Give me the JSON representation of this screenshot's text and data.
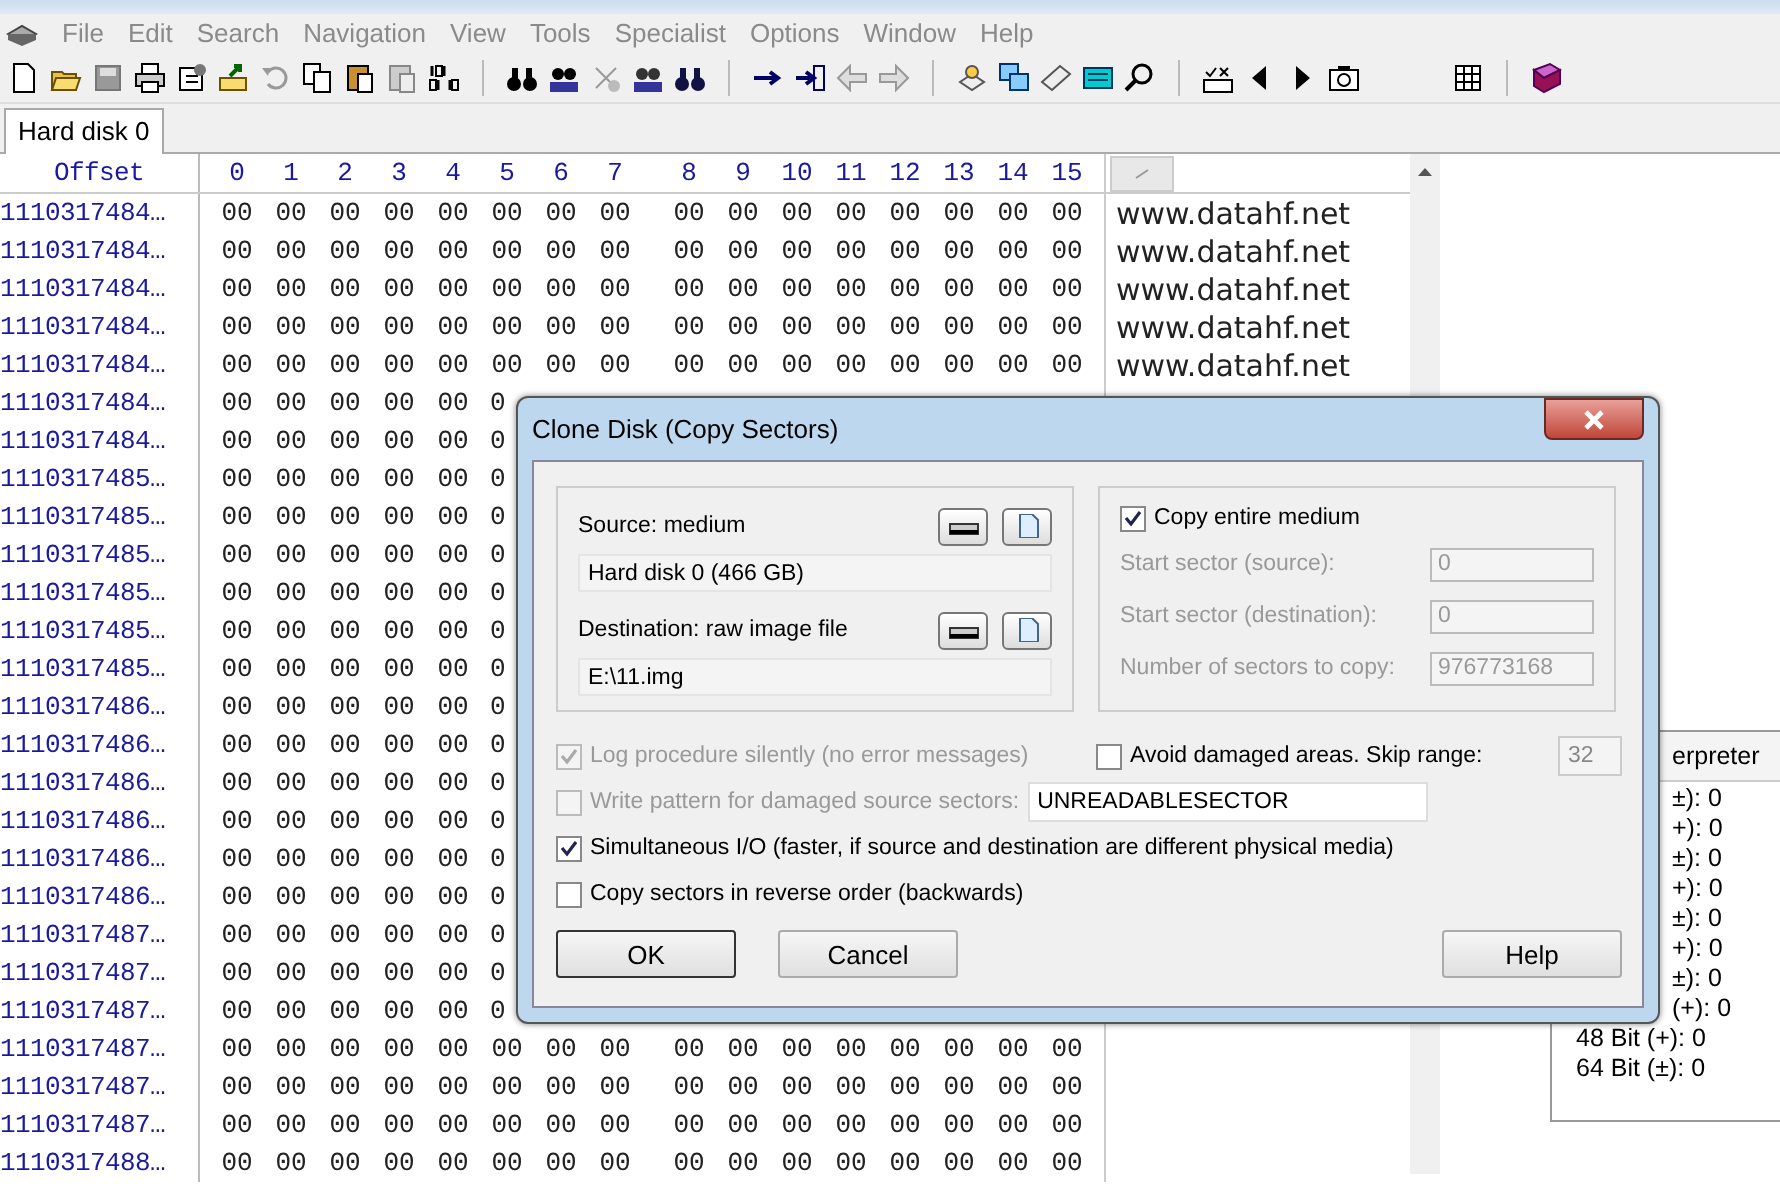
{
  "menu": [
    {
      "label": "File"
    },
    {
      "label": "Edit"
    },
    {
      "label": "Search"
    },
    {
      "label": "Navigation"
    },
    {
      "label": "View"
    },
    {
      "label": "Tools"
    },
    {
      "label": "Specialist"
    },
    {
      "label": "Options"
    },
    {
      "label": "Window"
    },
    {
      "label": "Help"
    }
  ],
  "tabs": [
    {
      "label": "Hard disk 0",
      "selected": true
    }
  ],
  "hex": {
    "offset_header": "Offset",
    "columns": [
      "0",
      "1",
      "2",
      "3",
      "4",
      "5",
      "6",
      "7",
      "8",
      "9",
      "10",
      "11",
      "12",
      "13",
      "14",
      "15"
    ],
    "rows": [
      {
        "offset": "1110317484…",
        "cells": [
          "00",
          "00",
          "00",
          "00",
          "00",
          "00",
          "00",
          "00",
          "00",
          "00",
          "00",
          "00",
          "00",
          "00",
          "00",
          "00"
        ],
        "text": "www.datahf.net"
      },
      {
        "offset": "1110317484…",
        "cells": [
          "00",
          "00",
          "00",
          "00",
          "00",
          "00",
          "00",
          "00",
          "00",
          "00",
          "00",
          "00",
          "00",
          "00",
          "00",
          "00"
        ],
        "text": "www.datahf.net"
      },
      {
        "offset": "1110317484…",
        "cells": [
          "00",
          "00",
          "00",
          "00",
          "00",
          "00",
          "00",
          "00",
          "00",
          "00",
          "00",
          "00",
          "00",
          "00",
          "00",
          "00"
        ],
        "text": "www.datahf.net"
      },
      {
        "offset": "1110317484…",
        "cells": [
          "00",
          "00",
          "00",
          "00",
          "00",
          "00",
          "00",
          "00",
          "00",
          "00",
          "00",
          "00",
          "00",
          "00",
          "00",
          "00"
        ],
        "text": "www.datahf.net"
      },
      {
        "offset": "1110317484…",
        "cells": [
          "00",
          "00",
          "00",
          "00",
          "00",
          "00",
          "00",
          "00",
          "00",
          "00",
          "00",
          "00",
          "00",
          "00",
          "00",
          "00"
        ],
        "text": "www.datahf.net"
      },
      {
        "offset": "1110317484…",
        "cells": [
          "00",
          "00",
          "00",
          "00",
          "00",
          "0"
        ]
      },
      {
        "offset": "1110317484…",
        "cells": [
          "00",
          "00",
          "00",
          "00",
          "00",
          "0"
        ]
      },
      {
        "offset": "1110317485…",
        "cells": [
          "00",
          "00",
          "00",
          "00",
          "00",
          "0"
        ]
      },
      {
        "offset": "1110317485…",
        "cells": [
          "00",
          "00",
          "00",
          "00",
          "00",
          "0"
        ]
      },
      {
        "offset": "1110317485…",
        "cells": [
          "00",
          "00",
          "00",
          "00",
          "00",
          "0"
        ]
      },
      {
        "offset": "1110317485…",
        "cells": [
          "00",
          "00",
          "00",
          "00",
          "00",
          "0"
        ]
      },
      {
        "offset": "1110317485…",
        "cells": [
          "00",
          "00",
          "00",
          "00",
          "00",
          "0"
        ]
      },
      {
        "offset": "1110317485…",
        "cells": [
          "00",
          "00",
          "00",
          "00",
          "00",
          "0"
        ]
      },
      {
        "offset": "1110317486…",
        "cells": [
          "00",
          "00",
          "00",
          "00",
          "00",
          "0"
        ]
      },
      {
        "offset": "1110317486…",
        "cells": [
          "00",
          "00",
          "00",
          "00",
          "00",
          "0"
        ]
      },
      {
        "offset": "1110317486…",
        "cells": [
          "00",
          "00",
          "00",
          "00",
          "00",
          "0"
        ]
      },
      {
        "offset": "1110317486…",
        "cells": [
          "00",
          "00",
          "00",
          "00",
          "00",
          "0"
        ]
      },
      {
        "offset": "1110317486…",
        "cells": [
          "00",
          "00",
          "00",
          "00",
          "00",
          "0"
        ]
      },
      {
        "offset": "1110317486…",
        "cells": [
          "00",
          "00",
          "00",
          "00",
          "00",
          "0"
        ]
      },
      {
        "offset": "1110317487…",
        "cells": [
          "00",
          "00",
          "00",
          "00",
          "00",
          "0"
        ]
      },
      {
        "offset": "1110317487…",
        "cells": [
          "00",
          "00",
          "00",
          "00",
          "00",
          "0"
        ]
      },
      {
        "offset": "1110317487…",
        "cells": [
          "00",
          "00",
          "00",
          "00",
          "00",
          "0"
        ]
      },
      {
        "offset": "1110317487…",
        "cells": [
          "00",
          "00",
          "00",
          "00",
          "00",
          "00",
          "00",
          "00",
          "00",
          "00",
          "00",
          "00",
          "00",
          "00",
          "00",
          "00"
        ]
      },
      {
        "offset": "1110317487…",
        "cells": [
          "00",
          "00",
          "00",
          "00",
          "00",
          "00",
          "00",
          "00",
          "00",
          "00",
          "00",
          "00",
          "00",
          "00",
          "00",
          "00"
        ]
      },
      {
        "offset": "1110317487…",
        "cells": [
          "00",
          "00",
          "00",
          "00",
          "00",
          "00",
          "00",
          "00",
          "00",
          "00",
          "00",
          "00",
          "00",
          "00",
          "00",
          "00"
        ]
      },
      {
        "offset": "1110317488…",
        "cells": [
          "00",
          "00",
          "00",
          "00",
          "00",
          "00",
          "00",
          "00",
          "00",
          "00",
          "00",
          "00",
          "00",
          "00",
          "00",
          "00"
        ]
      }
    ]
  },
  "interpreter": {
    "title": "erpreter",
    "rows": [
      {
        "text": "±): 0",
        "kind": "partial"
      },
      {
        "text": "+): 0",
        "kind": "partial"
      },
      {
        "text": "±): 0",
        "kind": "partial"
      },
      {
        "text": "+): 0",
        "kind": "partial"
      },
      {
        "text": "±): 0",
        "kind": "partial"
      },
      {
        "text": "+): 0",
        "kind": "partial"
      },
      {
        "text": "±): 0",
        "kind": "partial"
      },
      {
        "text": "(+): 0",
        "kind": "partial"
      },
      {
        "text": "48 Bit (+): 0",
        "kind": "full"
      },
      {
        "text": "64 Bit (±): 0",
        "kind": "full"
      }
    ]
  },
  "dialog": {
    "title": "Clone Disk (Copy Sectors)",
    "source": {
      "label": "Source: medium",
      "value": "Hard disk 0 (466 GB)"
    },
    "destination": {
      "label": "Destination: raw image file",
      "value": "E:\\11.img"
    },
    "copy_entire": {
      "label": "Copy entire medium",
      "checked": true,
      "disabled": false
    },
    "range_fields": [
      {
        "label": "Start sector (source):",
        "value": "0",
        "disabled": true
      },
      {
        "label": "Start sector (destination):",
        "value": "0",
        "disabled": true
      },
      {
        "label": "Number of sectors to copy:",
        "value": "976773168",
        "disabled": true
      }
    ],
    "log_silently": {
      "label": "Log procedure silently (no error messages)",
      "checked": true,
      "disabled": true
    },
    "avoid_damaged": {
      "label": "Avoid damaged areas. Skip range:",
      "checked": false,
      "disabled": false,
      "value": "32"
    },
    "write_pattern": {
      "label": "Write pattern for damaged source sectors:",
      "checked": false,
      "disabled": true,
      "value": "UNREADABLESECTOR"
    },
    "options": [
      {
        "label": "Simultaneous I/O (faster, if source and destination are different physical media)",
        "checked": true,
        "disabled": false
      },
      {
        "label": "Copy sectors in reverse order (backwards)",
        "checked": false,
        "disabled": false
      }
    ],
    "buttons": [
      {
        "label": "OK",
        "default": true
      },
      {
        "label": "Cancel",
        "default": false
      },
      {
        "label": "Help",
        "default": false
      }
    ]
  }
}
